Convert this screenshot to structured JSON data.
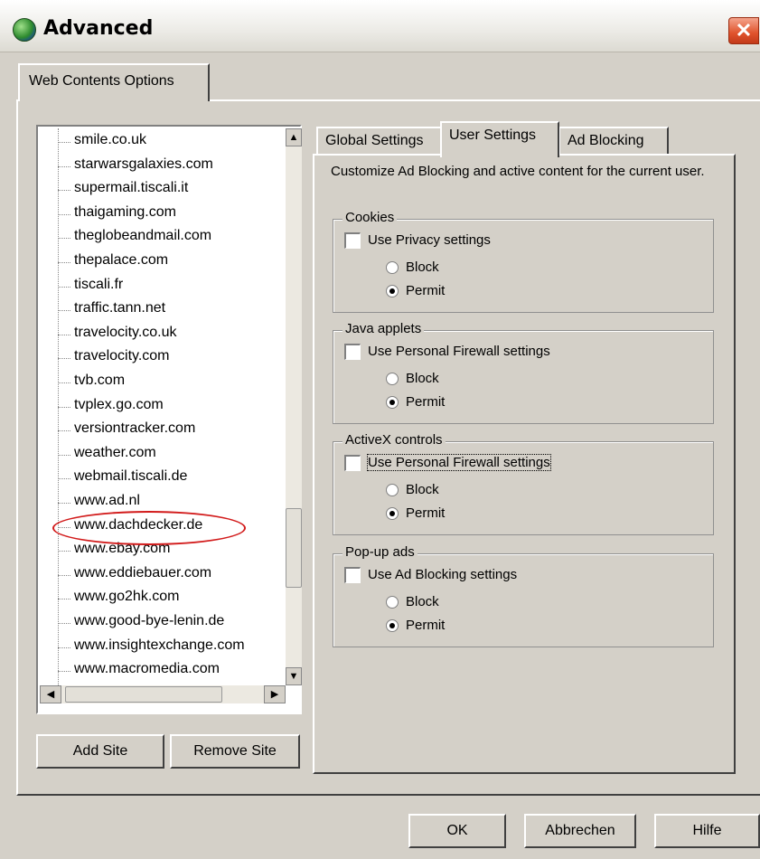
{
  "window": {
    "title": "Advanced",
    "close_glyph": "✕"
  },
  "outer_tab": {
    "label": "Web Contents Options"
  },
  "sites": [
    "smile.co.uk",
    "starwarsgalaxies.com",
    "supermail.tiscali.it",
    "thaigaming.com",
    "theglobeandmail.com",
    "thepalace.com",
    "tiscali.fr",
    "traffic.tann.net",
    "travelocity.co.uk",
    "travelocity.com",
    "tvb.com",
    "tvplex.go.com",
    "versiontracker.com",
    "weather.com",
    "webmail.tiscali.de",
    "www.ad.nl",
    "www.dachdecker.de",
    "www.ebay.com",
    "www.eddiebauer.com",
    "www.go2hk.com",
    "www.good-bye-lenin.de",
    "www.insightexchange.com",
    "www.macromedia.com"
  ],
  "highlighted_site": "www.dachdecker.de",
  "list_buttons": {
    "add": "Add Site",
    "remove": "Remove Site"
  },
  "inner_tabs": [
    {
      "label": "Global Settings",
      "active": false
    },
    {
      "label": "User Settings",
      "active": true
    },
    {
      "label": "Ad Blocking",
      "active": false
    }
  ],
  "description": "Customize Ad Blocking and active content for the current user.",
  "groups": [
    {
      "title": "Cookies",
      "checkbox": "Use Privacy settings",
      "block": "Block",
      "permit": "Permit",
      "selected": "permit"
    },
    {
      "title": "Java applets",
      "checkbox": "Use Personal Firewall settings",
      "block": "Block",
      "permit": "Permit",
      "selected": "permit"
    },
    {
      "title": "ActiveX controls",
      "checkbox": "Use Personal Firewall settings",
      "block": "Block",
      "permit": "Permit",
      "selected": "permit"
    },
    {
      "title": "Pop-up ads",
      "checkbox": "Use Ad Blocking settings",
      "block": "Block",
      "permit": "Permit",
      "selected": "permit"
    }
  ],
  "dialog_buttons": {
    "ok": "OK",
    "cancel": "Abbrechen",
    "help": "Hilfe"
  },
  "colors": {
    "annotation": "#d21b1b",
    "close": "#e0532c"
  }
}
